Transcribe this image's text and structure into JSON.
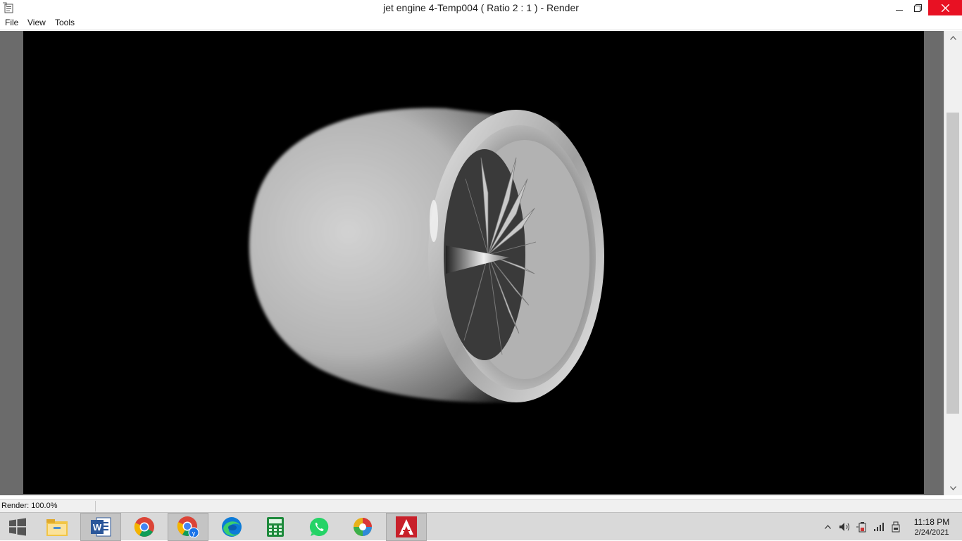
{
  "window": {
    "title": "jet engine 4-Temp004  ( Ratio 2 : 1 ) - Render",
    "app_icon": "render-window-icon",
    "controls": {
      "minimize": "minimize-icon",
      "maximize": "restore-icon",
      "close": "close-icon"
    }
  },
  "menu": {
    "items": [
      {
        "label": "File"
      },
      {
        "label": "View"
      },
      {
        "label": "Tools"
      }
    ]
  },
  "render": {
    "subject_icon": "jet-engine-render",
    "background_color": "#000000",
    "frame_color": "#6b6b6b"
  },
  "scrollbar": {
    "position_fraction": 0.18
  },
  "status": {
    "text": "Render: 100.0%"
  },
  "taskbar": {
    "apps": [
      {
        "icon": "file-explorer-icon",
        "state": "normal"
      },
      {
        "icon": "word-icon",
        "state": "active"
      },
      {
        "icon": "chrome-icon",
        "state": "normal"
      },
      {
        "icon": "chrome-profile-icon",
        "state": "active"
      },
      {
        "icon": "edge-icon",
        "state": "normal"
      },
      {
        "icon": "calculator-icon",
        "state": "normal"
      },
      {
        "icon": "whatsapp-icon",
        "state": "normal"
      },
      {
        "icon": "color-app-icon",
        "state": "normal"
      },
      {
        "icon": "autocad-icon",
        "state": "active"
      }
    ],
    "tray": [
      "show-hidden-icons",
      "volume-icon",
      "power-icon",
      "network-icon",
      "device-icon"
    ],
    "clock": {
      "time": "11:18 PM",
      "date": "2/24/2021"
    }
  },
  "colors": {
    "close_button": "#e81123",
    "taskbar": "#d9d9d9",
    "status_bar": "#f0f0f0"
  }
}
